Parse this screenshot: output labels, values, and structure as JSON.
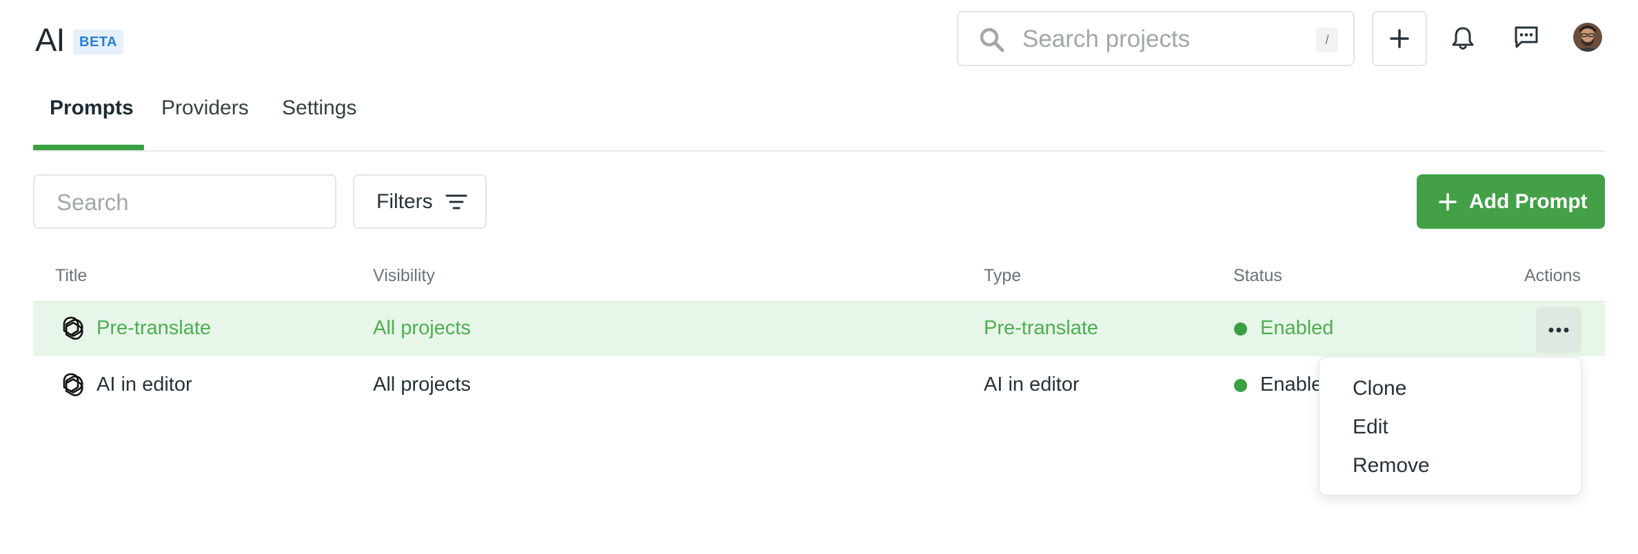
{
  "header": {
    "title": "AI",
    "badge": "BETA",
    "search_placeholder": "Search projects",
    "shortcut_hint": "/"
  },
  "tabs": [
    {
      "label": "Prompts",
      "active": true
    },
    {
      "label": "Providers",
      "active": false
    },
    {
      "label": "Settings",
      "active": false
    }
  ],
  "toolbar": {
    "search_placeholder": "Search",
    "filters_label": "Filters",
    "add_prompt_label": "Add Prompt"
  },
  "table": {
    "headers": {
      "title": "Title",
      "visibility": "Visibility",
      "type": "Type",
      "status": "Status",
      "actions": "Actions"
    },
    "rows": [
      {
        "title": "Pre-translate",
        "visibility": "All projects",
        "type": "Pre-translate",
        "status": "Enabled",
        "icon": "openai-icon"
      },
      {
        "title": "AI in editor",
        "visibility": "All projects",
        "type": "AI in editor",
        "status": "Enabled",
        "icon": "openai-icon"
      }
    ]
  },
  "actions_menu": {
    "items": [
      "Clone",
      "Edit",
      "Remove"
    ]
  },
  "colors": {
    "accent_green": "#43a047",
    "highlight_row": "#e8f5e9",
    "beta_badge_bg": "#e6f0fb",
    "beta_badge_text": "#2b7dd8"
  }
}
